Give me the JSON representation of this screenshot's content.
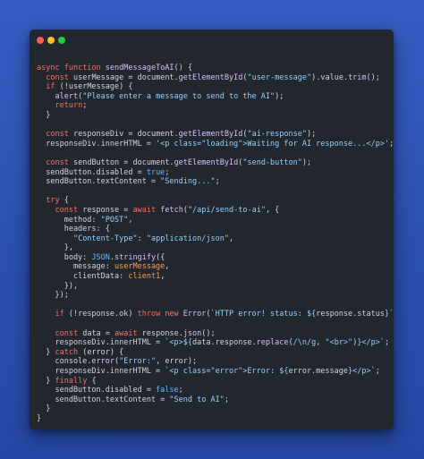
{
  "window": {
    "traffic_lights": [
      "close",
      "minimize",
      "zoom"
    ]
  },
  "code": {
    "lines": [
      [
        [
          "k",
          "async "
        ],
        [
          "k",
          "function "
        ],
        [
          "f",
          "sendMessageToAI"
        ],
        [
          "p",
          "() {"
        ]
      ],
      [
        [
          "p",
          "  "
        ],
        [
          "k",
          "const "
        ],
        [
          "p",
          "userMessage = document."
        ],
        [
          "f",
          "getElementById"
        ],
        [
          "p",
          "("
        ],
        [
          "s",
          "\"user-message\""
        ],
        [
          "p",
          ").value."
        ],
        [
          "f",
          "trim"
        ],
        [
          "p",
          "();"
        ]
      ],
      [
        [
          "p",
          "  "
        ],
        [
          "k",
          "if "
        ],
        [
          "p",
          "(!userMessage) {"
        ]
      ],
      [
        [
          "p",
          "    "
        ],
        [
          "f",
          "alert"
        ],
        [
          "p",
          "("
        ],
        [
          "s",
          "\"Please enter a message to send to the AI\""
        ],
        [
          "p",
          ");"
        ]
      ],
      [
        [
          "p",
          "    "
        ],
        [
          "k",
          "return"
        ],
        [
          "p",
          ";"
        ]
      ],
      [
        [
          "p",
          "  }"
        ]
      ],
      [
        [
          "p",
          ""
        ]
      ],
      [
        [
          "p",
          "  "
        ],
        [
          "k",
          "const "
        ],
        [
          "p",
          "responseDiv = document."
        ],
        [
          "f",
          "getElementById"
        ],
        [
          "p",
          "("
        ],
        [
          "s",
          "\"ai-response\""
        ],
        [
          "p",
          ");"
        ]
      ],
      [
        [
          "p",
          "  responseDiv.innerHTML = "
        ],
        [
          "s",
          "'<p class=\"loading\">Waiting for AI response...</p>'"
        ],
        [
          "p",
          ";"
        ]
      ],
      [
        [
          "p",
          ""
        ]
      ],
      [
        [
          "p",
          "  "
        ],
        [
          "k",
          "const "
        ],
        [
          "p",
          "sendButton = document."
        ],
        [
          "f",
          "getElementById"
        ],
        [
          "p",
          "("
        ],
        [
          "s",
          "\"send-button\""
        ],
        [
          "p",
          ");"
        ]
      ],
      [
        [
          "p",
          "  sendButton.disabled = "
        ],
        [
          "c",
          "true"
        ],
        [
          "p",
          ";"
        ]
      ],
      [
        [
          "p",
          "  sendButton.textContent = "
        ],
        [
          "s",
          "\"Sending...\""
        ],
        [
          "p",
          ";"
        ]
      ],
      [
        [
          "p",
          ""
        ]
      ],
      [
        [
          "p",
          "  "
        ],
        [
          "k",
          "try "
        ],
        [
          "p",
          "{"
        ]
      ],
      [
        [
          "p",
          "    "
        ],
        [
          "k",
          "const "
        ],
        [
          "p",
          "response = "
        ],
        [
          "k",
          "await "
        ],
        [
          "f",
          "fetch"
        ],
        [
          "p",
          "("
        ],
        [
          "s",
          "\"/api/send-to-ai\""
        ],
        [
          "p",
          ", {"
        ]
      ],
      [
        [
          "p",
          "      method: "
        ],
        [
          "s",
          "\"POST\""
        ],
        [
          "p",
          ","
        ]
      ],
      [
        [
          "p",
          "      headers: {"
        ]
      ],
      [
        [
          "p",
          "        "
        ],
        [
          "s",
          "\"Content-Type\""
        ],
        [
          "p",
          ": "
        ],
        [
          "s",
          "\"application/json\""
        ],
        [
          "p",
          ","
        ]
      ],
      [
        [
          "p",
          "      },"
        ]
      ],
      [
        [
          "p",
          "      body: "
        ],
        [
          "c",
          "JSON"
        ],
        [
          "p",
          "."
        ],
        [
          "f",
          "stringify"
        ],
        [
          "p",
          "({"
        ]
      ],
      [
        [
          "p",
          "        message: "
        ],
        [
          "v",
          "userMessage"
        ],
        [
          "p",
          ","
        ]
      ],
      [
        [
          "p",
          "        clientData: "
        ],
        [
          "v",
          "client1"
        ],
        [
          "p",
          ","
        ]
      ],
      [
        [
          "p",
          "      }),"
        ]
      ],
      [
        [
          "p",
          "    });"
        ]
      ],
      [
        [
          "p",
          ""
        ]
      ],
      [
        [
          "p",
          "    "
        ],
        [
          "k",
          "if "
        ],
        [
          "p",
          "(!response.ok) "
        ],
        [
          "k",
          "throw new "
        ],
        [
          "f",
          "Error"
        ],
        [
          "p",
          "("
        ],
        [
          "s",
          "`HTTP error! status: ${"
        ],
        [
          "p",
          "response.status"
        ],
        [
          "s",
          "}`"
        ],
        [
          "p",
          ");"
        ]
      ],
      [
        [
          "p",
          ""
        ]
      ],
      [
        [
          "p",
          "    "
        ],
        [
          "k",
          "const "
        ],
        [
          "p",
          "data = "
        ],
        [
          "k",
          "await "
        ],
        [
          "p",
          "response."
        ],
        [
          "f",
          "json"
        ],
        [
          "p",
          "();"
        ]
      ],
      [
        [
          "p",
          "    responseDiv.innerHTML = "
        ],
        [
          "s",
          "`<p>${"
        ],
        [
          "p",
          "data.response."
        ],
        [
          "f",
          "replace"
        ],
        [
          "p",
          "("
        ],
        [
          "s",
          "/\\n/g"
        ],
        [
          "p",
          ", "
        ],
        [
          "s",
          "\"<br>\""
        ],
        [
          "p",
          ")"
        ],
        [
          "s",
          "}</p>`"
        ],
        [
          "p",
          ";"
        ]
      ],
      [
        [
          "p",
          "  } "
        ],
        [
          "k",
          "catch "
        ],
        [
          "p",
          "(error) {"
        ]
      ],
      [
        [
          "p",
          "    console."
        ],
        [
          "f",
          "error"
        ],
        [
          "p",
          "("
        ],
        [
          "s",
          "\"Error:\""
        ],
        [
          "p",
          ", error);"
        ]
      ],
      [
        [
          "p",
          "    responseDiv.innerHTML = "
        ],
        [
          "s",
          "`<p class=\"error\">Error: ${"
        ],
        [
          "p",
          "error.message"
        ],
        [
          "s",
          "}</p>`"
        ],
        [
          "p",
          ";"
        ]
      ],
      [
        [
          "p",
          "  } "
        ],
        [
          "k",
          "finally "
        ],
        [
          "p",
          "{"
        ]
      ],
      [
        [
          "p",
          "    sendButton.disabled = "
        ],
        [
          "c",
          "false"
        ],
        [
          "p",
          ";"
        ]
      ],
      [
        [
          "p",
          "    sendButton.textContent = "
        ],
        [
          "s",
          "\"Send to AI\""
        ],
        [
          "p",
          ";"
        ]
      ],
      [
        [
          "p",
          "  }"
        ]
      ],
      [
        [
          "p",
          "}"
        ]
      ]
    ]
  }
}
